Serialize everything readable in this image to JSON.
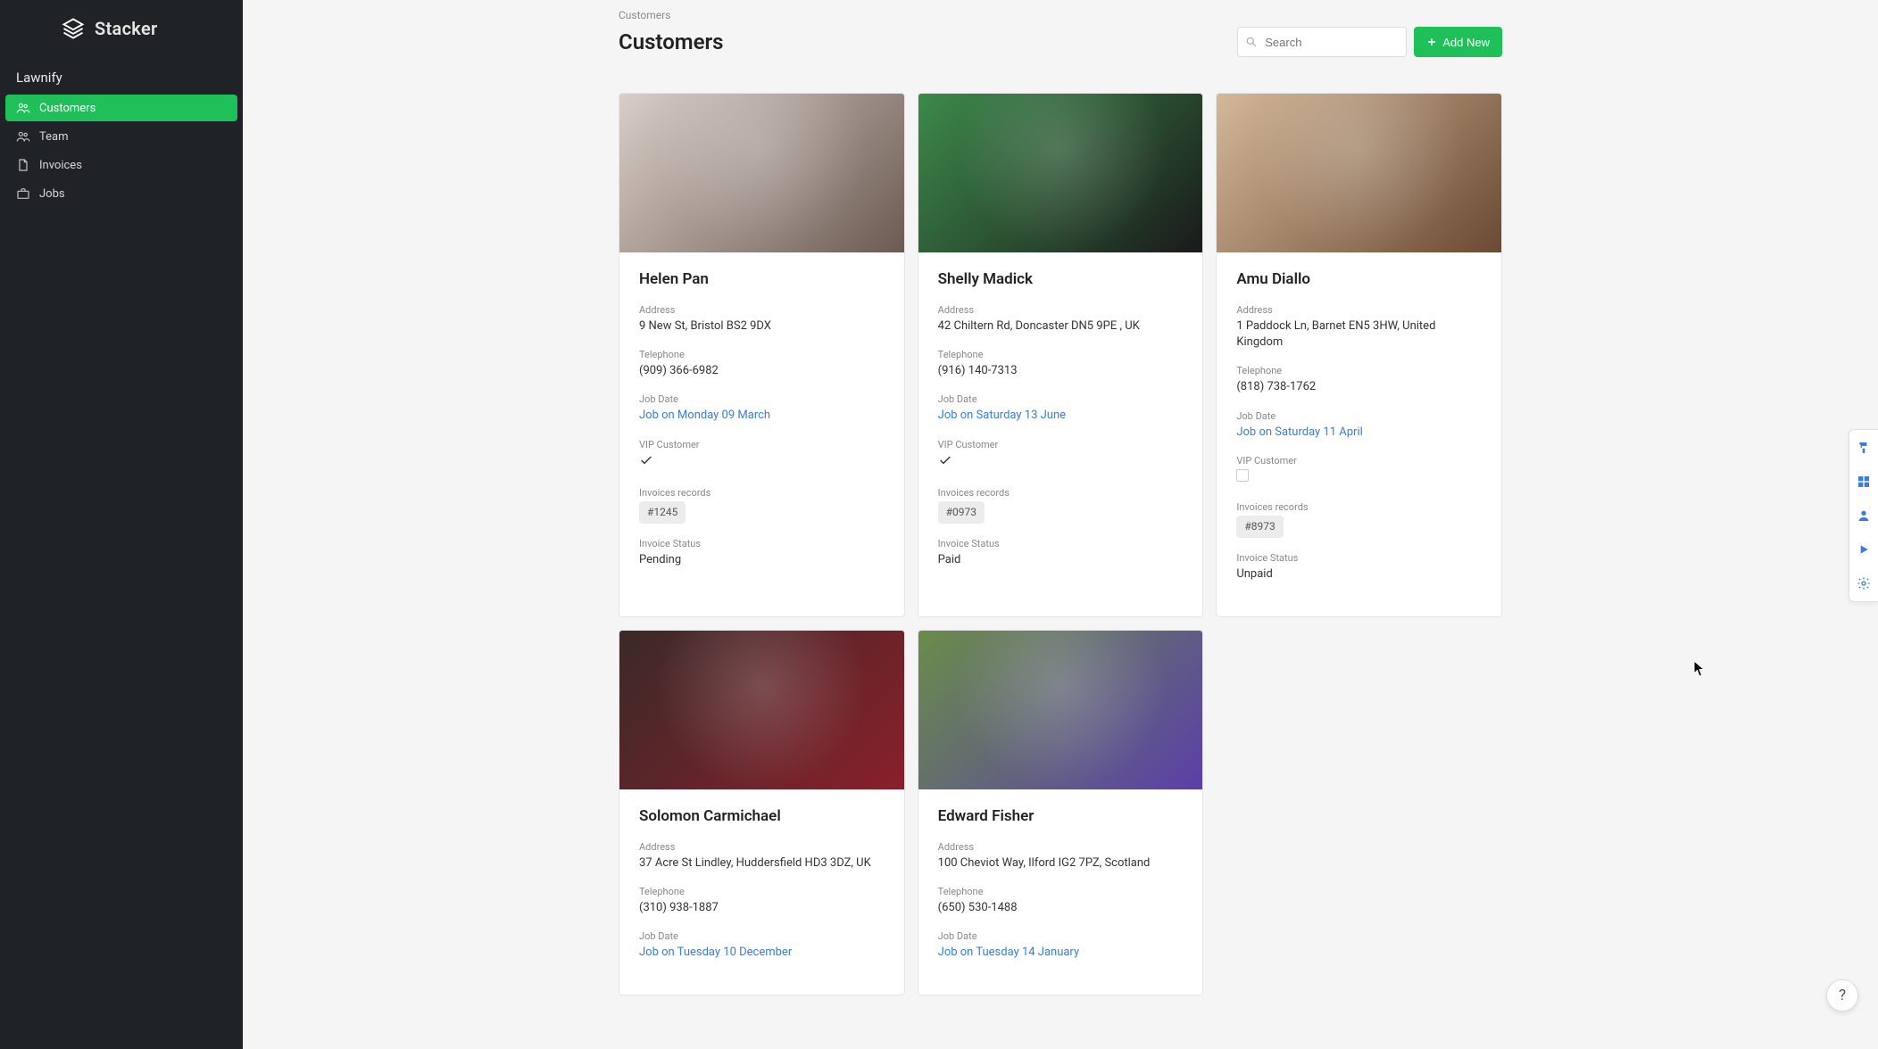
{
  "brand": "Stacker",
  "workspace": "Lawnify",
  "nav": [
    {
      "label": "Customers",
      "icon": "users",
      "active": true
    },
    {
      "label": "Team",
      "icon": "users",
      "active": false
    },
    {
      "label": "Invoices",
      "icon": "file",
      "active": false
    },
    {
      "label": "Jobs",
      "icon": "briefcase",
      "active": false
    }
  ],
  "breadcrumb": "Customers",
  "page_title": "Customers",
  "search_placeholder": "Search",
  "add_button_label": "Add New",
  "field_labels": {
    "address": "Address",
    "telephone": "Telephone",
    "job_date": "Job Date",
    "vip": "VIP Customer",
    "invoices": "Invoices records",
    "invoice_status": "Invoice Status"
  },
  "customers": [
    {
      "name": "Helen Pan",
      "address": "9 New St, Bristol BS2 9DX",
      "telephone": "(909) 366-6982",
      "job_date": "Job on Monday 09 March",
      "vip": true,
      "invoice_ref": "#1245",
      "invoice_status": "Pending",
      "img_colors": [
        "#d9cfc8",
        "#6b5a52"
      ]
    },
    {
      "name": "Shelly Madick",
      "address": "42 Chiltern Rd, Doncaster DN5 9PE , UK",
      "telephone": "(916) 140-7313",
      "job_date": "Job on Saturday 13 June",
      "vip": true,
      "invoice_ref": "#0973",
      "invoice_status": "Paid",
      "img_colors": [
        "#3c8a4a",
        "#1a1a1a"
      ]
    },
    {
      "name": "Amu Diallo",
      "address": "1 Paddock Ln, Barnet EN5 3HW, United Kingdom",
      "telephone": "(818) 738-1762",
      "job_date": "Job on Saturday 11 April",
      "vip": false,
      "invoice_ref": "#8973",
      "invoice_status": "Unpaid",
      "img_colors": [
        "#d4b89a",
        "#6a4a32"
      ]
    },
    {
      "name": "Solomon Carmichael",
      "address": "37 Acre St Lindley, Huddersfield HD3 3DZ, UK",
      "telephone": "(310) 938-1887",
      "job_date": "Job on Tuesday 10 December",
      "vip": null,
      "invoice_ref": null,
      "invoice_status": null,
      "img_colors": [
        "#3a2a28",
        "#8a1f2a"
      ]
    },
    {
      "name": "Edward Fisher",
      "address": "100 Cheviot Way, Ilford IG2 7PZ, Scotland",
      "telephone": "(650) 530-1488",
      "job_date": "Job on Tuesday 14 January",
      "vip": null,
      "invoice_ref": null,
      "invoice_status": null,
      "img_colors": [
        "#6a8c4a",
        "#5a3fa8"
      ]
    }
  ],
  "rail_tools": [
    {
      "name": "paint-icon"
    },
    {
      "name": "grid-icon"
    },
    {
      "name": "person-icon"
    },
    {
      "name": "play-icon"
    },
    {
      "name": "gear-icon"
    }
  ],
  "help_glyph": "?"
}
